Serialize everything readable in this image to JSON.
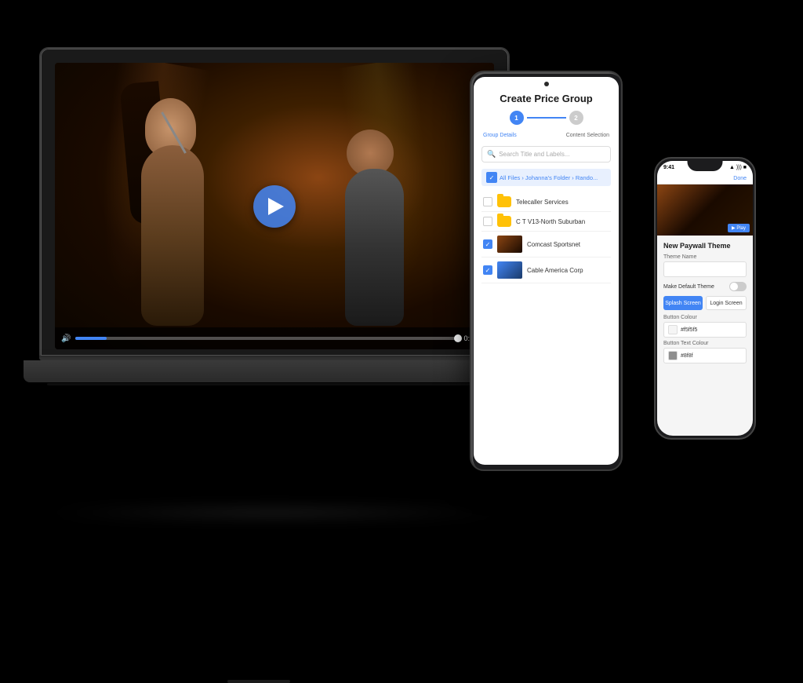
{
  "scene": {
    "background": "#000000"
  },
  "laptop": {
    "video": {
      "play_button_visible": true,
      "progress_time": "0:06",
      "progress_percent": 8
    }
  },
  "tablet": {
    "title": "Create Price Group",
    "stepper": {
      "step1_label": "Group Details",
      "step2_label": "Content Selection",
      "step1_number": "1",
      "step2_number": "2"
    },
    "search_placeholder": "Search Title and Labels...",
    "breadcrumb": "All Files › Johanna's Folder › Rando...",
    "files": [
      {
        "name": "Telecaller Services",
        "type": "folder",
        "checked": false
      },
      {
        "name": "C T V13-North Suburban",
        "type": "folder",
        "checked": false
      },
      {
        "name": "Comcast Sportsnet",
        "type": "video",
        "checked": true
      },
      {
        "name": "Cable America Corp",
        "type": "video",
        "checked": true
      }
    ]
  },
  "phone": {
    "status_time": "9:41",
    "status_icons": "▲ WiFi Batt",
    "nav_button": "Done",
    "section_title": "New Paywall Theme",
    "fields": {
      "theme_name_label": "Theme Name",
      "theme_name_value": "",
      "default_theme_label": "Make Default Theme",
      "button_color_label": "Button Colour",
      "button_color_value": "#f5f5f5",
      "button_text_color_label": "Button Text Colour",
      "button_text_color_value": "#8f8f"
    },
    "tab_splash": "Splash Screen",
    "tab_login": "Login Screen"
  }
}
